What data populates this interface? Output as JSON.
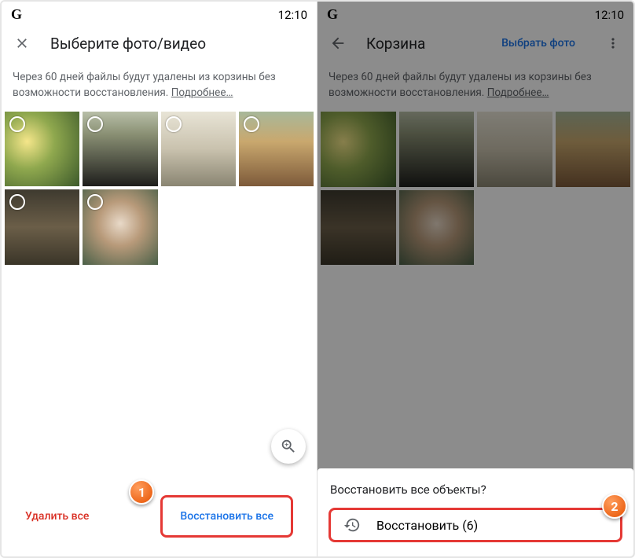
{
  "status": {
    "g": "G",
    "time": "12:10"
  },
  "left": {
    "title": "Выберите фото/видео",
    "info_text": "Через 60 дней файлы будут удалены из корзины без возможности восстановления.",
    "info_link": "Подробнее…",
    "delete_all": "Удалить все",
    "restore_all": "Восстановить все"
  },
  "right": {
    "title": "Корзина",
    "select_photo": "Выбрать фото",
    "info_text": "Через 60 дней файлы будут удалены из корзины без возможности восстановления.",
    "info_link": "Подробнее…",
    "sheet_title": "Восстановить все объекты?",
    "sheet_action": "Восстановить (6)"
  },
  "callouts": {
    "one": "1",
    "two": "2"
  }
}
